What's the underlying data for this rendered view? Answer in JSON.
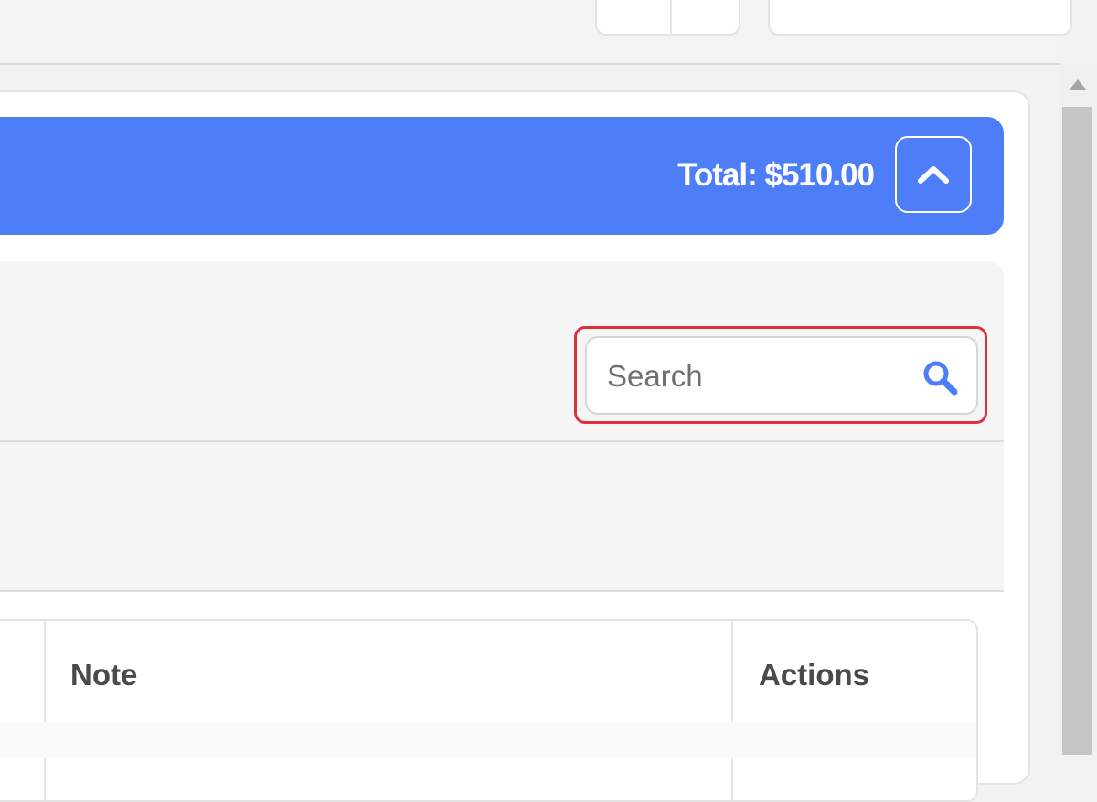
{
  "summary": {
    "total_label": "Total: $510.00"
  },
  "search": {
    "placeholder": "Search",
    "value": ""
  },
  "table": {
    "columns": [
      "Note",
      "Actions"
    ]
  },
  "colors": {
    "accent": "#4d7ef7",
    "highlight": "#e0303f"
  },
  "icons": {
    "collapse": "chevron-up-icon",
    "search": "search-icon"
  }
}
